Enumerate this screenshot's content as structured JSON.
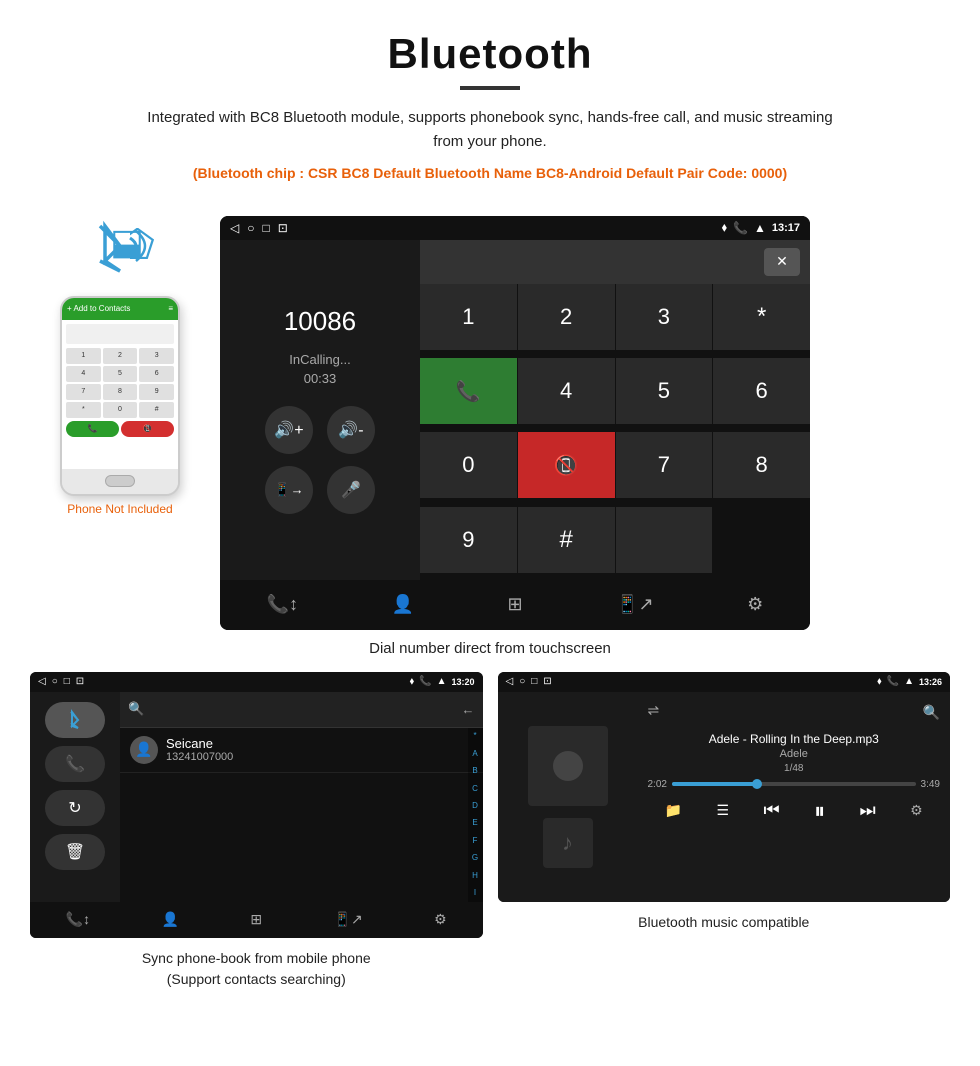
{
  "header": {
    "title": "Bluetooth",
    "description": "Integrated with BC8 Bluetooth module, supports phonebook sync, hands-free call, and music streaming from your phone.",
    "specs": "(Bluetooth chip : CSR BC8    Default Bluetooth Name BC8-Android    Default Pair Code: 0000)"
  },
  "dial_screen": {
    "status_bar": {
      "back_icon": "◁",
      "home_icon": "○",
      "recents_icon": "□",
      "screenshot_icon": "⬛",
      "location_icon": "♦",
      "call_icon": "📞",
      "wifi_icon": "▲",
      "time": "13:17"
    },
    "number": "10086",
    "status": "InCalling...",
    "timer": "00:33",
    "keypad": [
      "1",
      "2",
      "3",
      "*",
      "4",
      "5",
      "6",
      "0",
      "7",
      "8",
      "9",
      "#"
    ],
    "caption": "Dial number direct from touchscreen"
  },
  "phonebook_screen": {
    "status_bar": {
      "time": "13:20"
    },
    "contact_name": "Seicane",
    "contact_number": "13241007000",
    "alphabet": [
      "*",
      "A",
      "B",
      "C",
      "D",
      "E",
      "F",
      "G",
      "H",
      "I"
    ],
    "caption_line1": "Sync phone-book from mobile phone",
    "caption_line2": "(Support contacts searching)"
  },
  "music_screen": {
    "status_bar": {
      "time": "13:26"
    },
    "song_title": "Adele - Rolling In the Deep.mp3",
    "artist": "Adele",
    "track_info": "1/48",
    "time_current": "2:02",
    "time_total": "3:49",
    "caption": "Bluetooth music compatible"
  },
  "phone_graphic": {
    "not_included": "Phone Not Included"
  }
}
